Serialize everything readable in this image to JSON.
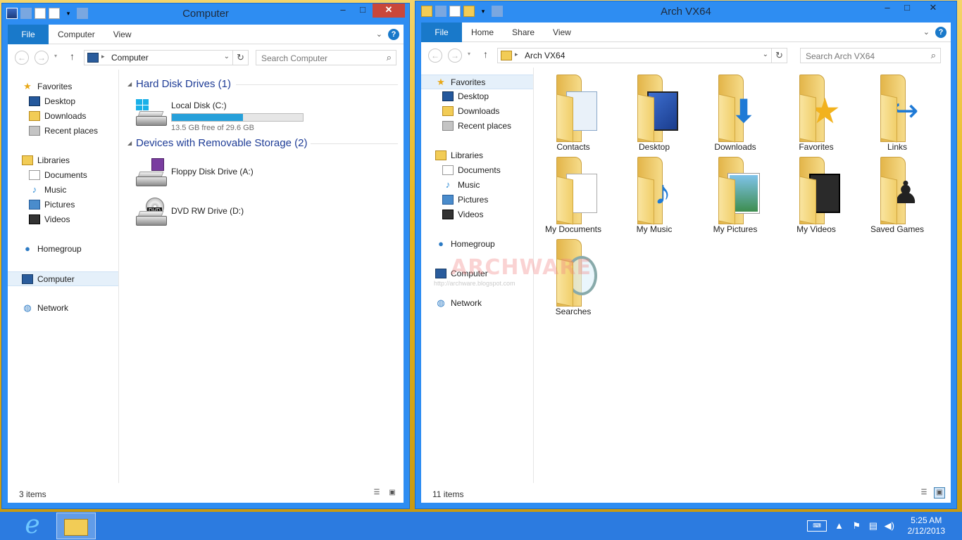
{
  "left_window": {
    "title": "Computer",
    "ribbon": {
      "file": "File",
      "tabs": [
        "Computer",
        "View"
      ]
    },
    "address": "Computer",
    "search_placeholder": "Search Computer",
    "nav": {
      "favorites": "Favorites",
      "desktop": "Desktop",
      "downloads": "Downloads",
      "recent": "Recent places",
      "libraries": "Libraries",
      "documents": "Documents",
      "music": "Music",
      "pictures": "Pictures",
      "videos": "Videos",
      "homegroup": "Homegroup",
      "computer": "Computer",
      "network": "Network"
    },
    "groups": {
      "hdd": "Hard Disk Drives (1)",
      "removable": "Devices with Removable Storage (2)"
    },
    "drives": {
      "local": {
        "name": "Local Disk (C:)",
        "free": "13.5 GB free of 29.6 GB",
        "used_fraction": 0.544
      },
      "floppy": {
        "name": "Floppy Disk Drive (A:)"
      },
      "dvd": {
        "name": "DVD RW Drive (D:)",
        "tag": "DVD"
      }
    },
    "status": "3 items"
  },
  "right_window": {
    "title": "Arch VX64",
    "ribbon": {
      "file": "File",
      "tabs": [
        "Home",
        "Share",
        "View"
      ]
    },
    "address": "Arch VX64",
    "search_placeholder": "Search Arch VX64",
    "nav": {
      "favorites": "Favorites",
      "desktop": "Desktop",
      "downloads": "Downloads",
      "recent": "Recent places",
      "libraries": "Libraries",
      "documents": "Documents",
      "music": "Music",
      "pictures": "Pictures",
      "videos": "Videos",
      "homegroup": "Homegroup",
      "computer": "Computer",
      "network": "Network"
    },
    "folders": [
      "Contacts",
      "Desktop",
      "Downloads",
      "Favorites",
      "Links",
      "My Documents",
      "My Music",
      "My Pictures",
      "My Videos",
      "Saved Games",
      "Searches"
    ],
    "status": "11 items"
  },
  "watermark": {
    "text": "ARCHWARE",
    "url": "http://archware.blogspot.com"
  },
  "taskbar": {
    "time": "5:25 AM",
    "date": "2/12/2013"
  },
  "colors": {
    "accent": "#2e8df2",
    "file_tab": "#1979ca",
    "taskbar": "#2c7be0",
    "close": "#c9473a",
    "progress": "#26a0da"
  }
}
